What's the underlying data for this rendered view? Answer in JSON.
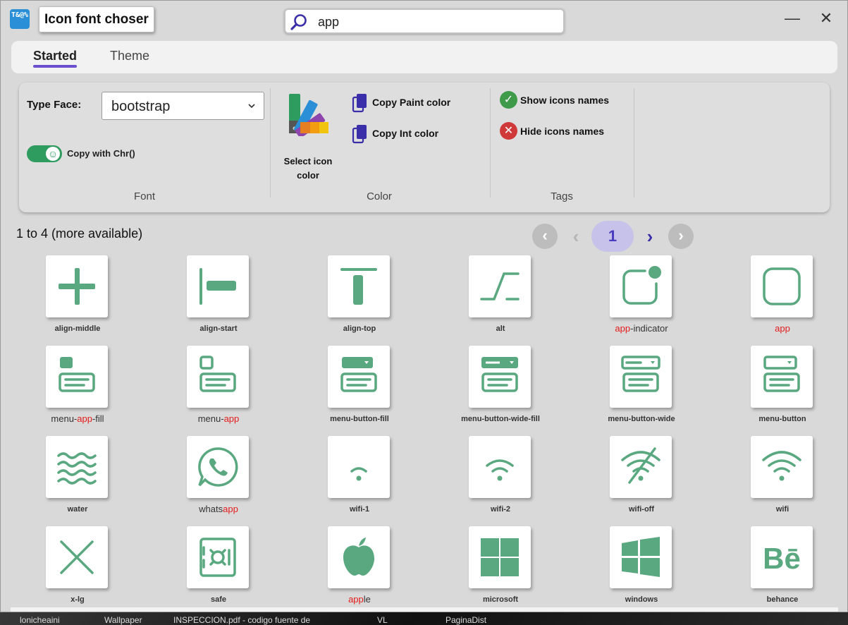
{
  "window": {
    "app_icon_text": "T&@%",
    "title": "Icon font choser",
    "search": {
      "value": "app",
      "placeholder": ""
    },
    "minimize": "—",
    "close": "✕"
  },
  "tabs": [
    {
      "label": "Started",
      "active": true
    },
    {
      "label": "Theme",
      "active": false
    }
  ],
  "ribbon": {
    "font": {
      "group_label": "Font",
      "typeface_label": "Type Face:",
      "typeface_value": "bootstrap",
      "copy_chr_label": "Copy with Chr()",
      "copy_chr_on": true
    },
    "color": {
      "group_label": "Color",
      "select_icon_color_line1": "Select icon",
      "select_icon_color_line2": "color",
      "copy_paint": "Copy Paint color",
      "copy_int": "Copy Int color"
    },
    "tags": {
      "group_label": "Tags",
      "show_names": "Show icons names",
      "hide_names": "Hide icons names"
    }
  },
  "results": {
    "count_text": "1 to 4 (more available)",
    "current_page": "1",
    "pager_icons": [
      "first-page-icon",
      "prev-page-icon",
      "next-page-icon",
      "last-page-icon"
    ]
  },
  "accent": "#5aa880",
  "highlight_color": "#e31b1b",
  "icons": [
    {
      "name": "align-middle",
      "pre": "align-middle",
      "hl": "",
      "post": "",
      "plain": false,
      "glyph": "align-middle"
    },
    {
      "name": "align-start",
      "pre": "align-start",
      "hl": "",
      "post": "",
      "plain": false,
      "glyph": "align-start"
    },
    {
      "name": "align-top",
      "pre": "align-top",
      "hl": "",
      "post": "",
      "plain": false,
      "glyph": "align-top"
    },
    {
      "name": "alt",
      "pre": "alt",
      "hl": "",
      "post": "",
      "plain": false,
      "glyph": "alt"
    },
    {
      "name": "app-indicator",
      "pre": "",
      "hl": "app",
      "post": "-indicator",
      "plain": true,
      "glyph": "app-indicator"
    },
    {
      "name": "app",
      "pre": "",
      "hl": "app",
      "post": "",
      "plain": true,
      "glyph": "app"
    },
    {
      "name": "menu-app-fill",
      "pre": "menu-",
      "hl": "app",
      "post": "-fill",
      "plain": true,
      "glyph": "menu-app-fill"
    },
    {
      "name": "menu-app",
      "pre": "menu-",
      "hl": "app",
      "post": "",
      "plain": true,
      "glyph": "menu-app"
    },
    {
      "name": "menu-button-fill",
      "pre": "menu-button-fill",
      "hl": "",
      "post": "",
      "plain": false,
      "glyph": "menu-button-fill"
    },
    {
      "name": "menu-button-wide-fill",
      "pre": "menu-button-wide-fill",
      "hl": "",
      "post": "",
      "plain": false,
      "glyph": "menu-button-wide-fill"
    },
    {
      "name": "menu-button-wide",
      "pre": "menu-button-wide",
      "hl": "",
      "post": "",
      "plain": false,
      "glyph": "menu-button-wide"
    },
    {
      "name": "menu-button",
      "pre": "menu-button",
      "hl": "",
      "post": "",
      "plain": false,
      "glyph": "menu-button"
    },
    {
      "name": "water",
      "pre": "water",
      "hl": "",
      "post": "",
      "plain": false,
      "glyph": "water"
    },
    {
      "name": "whatsapp",
      "pre": "whats",
      "hl": "app",
      "post": "",
      "plain": true,
      "glyph": "whatsapp"
    },
    {
      "name": "wifi-1",
      "pre": "wifi-1",
      "hl": "",
      "post": "",
      "plain": false,
      "glyph": "wifi-1"
    },
    {
      "name": "wifi-2",
      "pre": "wifi-2",
      "hl": "",
      "post": "",
      "plain": false,
      "glyph": "wifi-2"
    },
    {
      "name": "wifi-off",
      "pre": "wifi-off",
      "hl": "",
      "post": "",
      "plain": false,
      "glyph": "wifi-off"
    },
    {
      "name": "wifi",
      "pre": "wifi",
      "hl": "",
      "post": "",
      "plain": false,
      "glyph": "wifi"
    },
    {
      "name": "x-lg",
      "pre": "x-lg",
      "hl": "",
      "post": "",
      "plain": false,
      "glyph": "x-lg"
    },
    {
      "name": "safe",
      "pre": "safe",
      "hl": "",
      "post": "",
      "plain": false,
      "glyph": "safe"
    },
    {
      "name": "apple",
      "pre": "",
      "hl": "app",
      "post": "le",
      "plain": true,
      "glyph": "apple"
    },
    {
      "name": "microsoft",
      "pre": "microsoft",
      "hl": "",
      "post": "",
      "plain": false,
      "glyph": "microsoft"
    },
    {
      "name": "windows",
      "pre": "windows",
      "hl": "",
      "post": "",
      "plain": false,
      "glyph": "windows"
    },
    {
      "name": "behance",
      "pre": "behance",
      "hl": "",
      "post": "",
      "plain": false,
      "glyph": "behance"
    }
  ],
  "taskbar": [
    "lonicheaini",
    "Wallpaper",
    "INSPECCION.pdf - codigo fuente de",
    "VL",
    "PaginaDist"
  ]
}
